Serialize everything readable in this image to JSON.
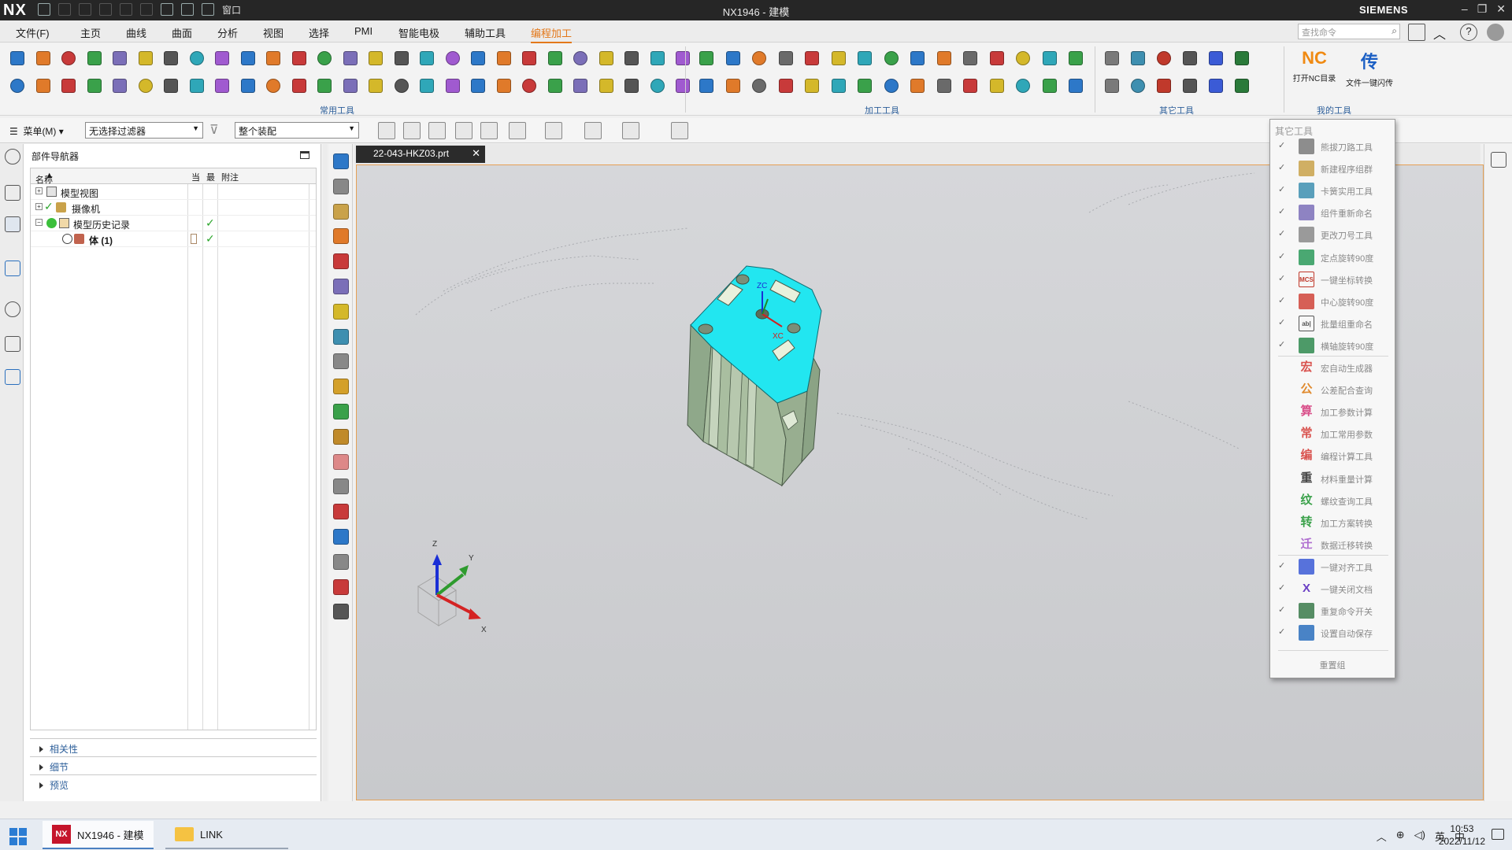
{
  "app": {
    "logo": "NX",
    "window_title": "NX1946 - 建模",
    "brand": "SIEMENS",
    "qa_window": "窗口"
  },
  "menubar": {
    "items": [
      "文件(F)",
      "主页",
      "曲线",
      "曲面",
      "分析",
      "视图",
      "选择",
      "PMI",
      "智能电极",
      "辅助工具",
      "编程加工"
    ],
    "active_index": 10,
    "search_placeholder": "查找命令"
  },
  "ribbon": {
    "groups": [
      "常用工具",
      "加工工具",
      "其它工具",
      "我的工具"
    ],
    "big_buttons": [
      {
        "icon_text": "NC",
        "label": "打开NC目录"
      },
      {
        "icon_text": "传",
        "label": "文件一键闪传"
      }
    ]
  },
  "toolbar2": {
    "menu_label": "菜单(M)",
    "filter": "无选择过滤器",
    "assembly": "整个装配"
  },
  "navigator": {
    "title": "部件导航器",
    "columns": [
      "名称",
      "当",
      "最",
      "附注"
    ],
    "rows": [
      {
        "label": "模型视图",
        "expand": "+",
        "level": 0,
        "checks": false
      },
      {
        "label": "摄像机",
        "expand": "+",
        "level": 0,
        "checks": false
      },
      {
        "label": "模型历史记录",
        "expand": "−",
        "level": 0,
        "checks": true
      },
      {
        "label": "体 (1)",
        "expand": "",
        "level": 1,
        "checks": true
      }
    ],
    "sections": [
      "相关性",
      "细节",
      "预览"
    ]
  },
  "document_tab": "22-043-HKZ03.prt",
  "triad": {
    "z": "Z",
    "y": "Y",
    "x": "X"
  },
  "model_labels": {
    "zc": "ZC",
    "xc": "XC"
  },
  "dropdown": {
    "title": "其它工具",
    "items": [
      {
        "label": "熊拔刀路工具",
        "checked": true,
        "icon": "bear-icon",
        "glyph": "",
        "color": "#7a7a7a"
      },
      {
        "label": "新建程序组群",
        "checked": true,
        "icon": "folder-tree-icon",
        "glyph": "",
        "color": "#c9a24a"
      },
      {
        "label": "卡簧实用工具",
        "checked": true,
        "icon": "clip-icon",
        "glyph": "",
        "color": "#3e8fb0"
      },
      {
        "label": "组件重新命名",
        "checked": true,
        "icon": "rename-icon",
        "glyph": "",
        "color": "#7b6fb8"
      },
      {
        "label": "更改刀号工具",
        "checked": true,
        "icon": "tool-number-icon",
        "glyph": "",
        "color": "#8a8a8a"
      },
      {
        "label": "定点旋转90度",
        "checked": true,
        "icon": "rotate-point-icon",
        "glyph": "",
        "color": "#2b9a5b"
      },
      {
        "label": "一键坐标转换",
        "checked": true,
        "icon": "mcs-icon",
        "glyph": "MCS",
        "color": "#c0392b"
      },
      {
        "label": "中心旋转90度",
        "checked": true,
        "icon": "rotate-center-icon",
        "glyph": "",
        "color": "#d0443a"
      },
      {
        "label": "批量组重命名",
        "checked": true,
        "icon": "batch-rename-icon",
        "glyph": "ab|",
        "color": "#555555"
      },
      {
        "label": "横轴旋转90度",
        "checked": true,
        "icon": "rotate-axis-icon",
        "glyph": "",
        "color": "#2f8a4f"
      },
      {
        "label": "宏自动生成器",
        "checked": false,
        "icon": "macro-icon",
        "glyph": "宏",
        "color": "#d9534f"
      },
      {
        "label": "公差配合查询",
        "checked": false,
        "icon": "tolerance-icon",
        "glyph": "公",
        "color": "#e08a2e"
      },
      {
        "label": "加工参数计算",
        "checked": false,
        "icon": "calc-icon",
        "glyph": "算",
        "color": "#d94f8a"
      },
      {
        "label": "加工常用参数",
        "checked": false,
        "icon": "params-icon",
        "glyph": "常",
        "color": "#d9534f"
      },
      {
        "label": "编程计算工具",
        "checked": false,
        "icon": "program-calc-icon",
        "glyph": "编",
        "color": "#d9534f"
      },
      {
        "label": "材料重量计算",
        "checked": false,
        "icon": "weight-icon",
        "glyph": "重",
        "color": "#444444"
      },
      {
        "label": "螺纹查询工具",
        "checked": false,
        "icon": "thread-icon",
        "glyph": "纹",
        "color": "#3aa14a"
      },
      {
        "label": "加工方案转换",
        "checked": false,
        "icon": "convert-icon",
        "glyph": "转",
        "color": "#3aa14a"
      },
      {
        "label": "数据迁移转换",
        "checked": false,
        "icon": "migrate-icon",
        "glyph": "迁",
        "color": "#b06fd0"
      },
      {
        "label": "一键对齐工具",
        "checked": true,
        "icon": "align-icon",
        "glyph": "",
        "color": "#3b5bd6"
      },
      {
        "label": "一键关闭文档",
        "checked": true,
        "icon": "close-doc-icon",
        "glyph": "X",
        "color": "#6a3fc4"
      },
      {
        "label": "重复命令开关",
        "checked": true,
        "icon": "repeat-icon",
        "glyph": "",
        "color": "#3a7a4a"
      },
      {
        "label": "设置自动保存",
        "checked": true,
        "icon": "save-icon",
        "glyph": "",
        "color": "#2a6fbd"
      }
    ],
    "footer": "重置组"
  },
  "taskbar": {
    "tasks": [
      {
        "badge": "NX",
        "label": "NX1946 - 建模",
        "active": true
      },
      {
        "badge": "",
        "label": "LINK",
        "active": false
      }
    ],
    "tray_lang": "英",
    "tray_ime": "中",
    "time": "10:53",
    "date": "2022/11/12"
  },
  "colors": {
    "accent": "#e3781a",
    "title_bg": "#262626",
    "model_top": "#22e6f0",
    "model_side": "#a9bea0"
  }
}
